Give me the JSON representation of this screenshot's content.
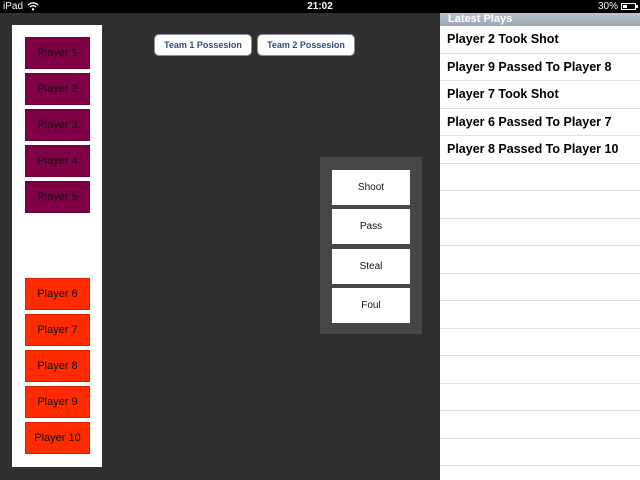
{
  "status_bar": {
    "carrier": "iPad",
    "time": "21:02",
    "battery_pct": "30%"
  },
  "roster": {
    "team1": [
      "Player 1",
      "Player 2",
      "Player 3",
      "Player 4",
      "Player 5"
    ],
    "team2": [
      "Player 6",
      "Player 7",
      "Player 8",
      "Player 9",
      "Player 10"
    ]
  },
  "possession": {
    "team1_label": "Team 1 Possesion",
    "team2_label": "Team 2 Possesion"
  },
  "actions": {
    "shoot": "Shoot",
    "pass": "Pass",
    "steal": "Steal",
    "foul": "Foul"
  },
  "latest_plays": {
    "title": "Latest Plays",
    "items": [
      "Player 2 Took Shot",
      "Player 9 Passed To Player 8",
      "Player 7 Took Shot",
      "Player 6 Passed To Player 7",
      "Player 8 Passed To Player 10"
    ]
  },
  "colors": {
    "team1": "#7f0045",
    "team2": "#ff2a00",
    "background": "#303030",
    "panel": "#474747"
  }
}
